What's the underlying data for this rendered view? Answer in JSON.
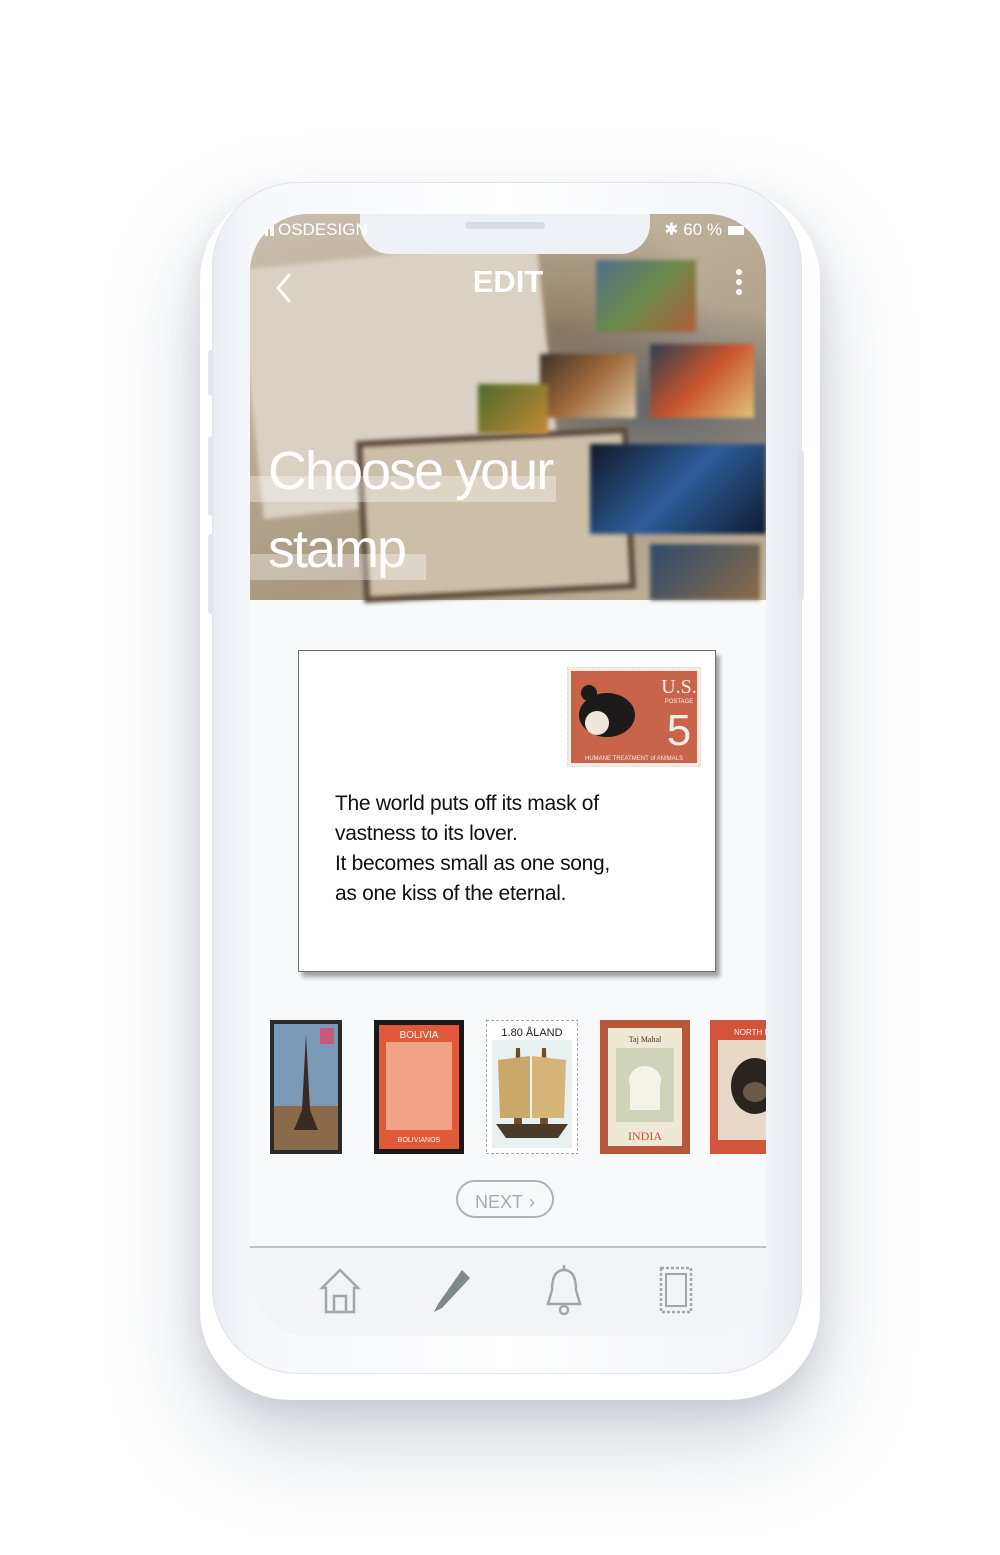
{
  "status_bar": {
    "carrier": "OSDESIGN",
    "battery": "60 %"
  },
  "header": {
    "title": "EDIT"
  },
  "hero": {
    "title_line1": "Choose your",
    "title_line2": "stamp"
  },
  "card": {
    "stamp_text": {
      "country": "U.S.",
      "postage": "POSTAGE",
      "value": "5",
      "caption": "HUMANE TREATMENT of ANIMALS"
    },
    "message_lines": [
      "The world puts off its mask of",
      "vastness to its lover.",
      "It becomes small as one song,",
      "as one kiss of the eternal."
    ]
  },
  "stamps": [
    {
      "name": "eiffel-tower-stamp"
    },
    {
      "name": "bolivia-stamp",
      "label": "BOLIVIA",
      "sub": "BOLIVIANOS"
    },
    {
      "name": "aland-ship-stamp",
      "label": "1.80 ÅLAND"
    },
    {
      "name": "india-taj-mahal-stamp",
      "label": "INDIA",
      "sub": "Taj Mahal"
    },
    {
      "name": "north-borneo-stamp",
      "label": "NORTH BO"
    }
  ],
  "next_button": {
    "label": "NEXT"
  },
  "tabbar": {
    "items": [
      {
        "icon": "home-icon"
      },
      {
        "icon": "pencil-icon"
      },
      {
        "icon": "bell-icon"
      },
      {
        "icon": "stamp-icon"
      }
    ]
  }
}
